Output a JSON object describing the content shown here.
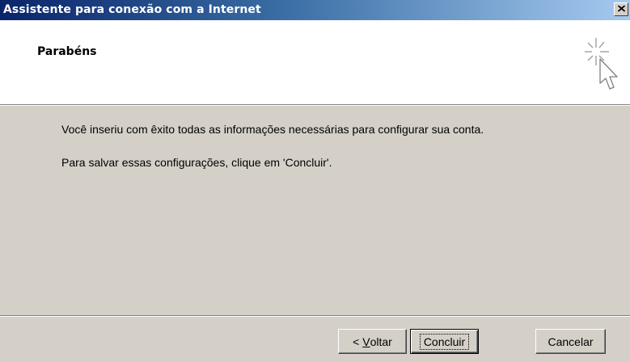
{
  "window": {
    "title": "Assistente para conexão com a Internet",
    "close_icon": "close-x-icon"
  },
  "header": {
    "title": "Parabéns",
    "icon": "wizard-cursor-sparkle-icon"
  },
  "body": {
    "line1": "Você inseriu com êxito todas as informações necessárias para configurar sua conta.",
    "line2": "Para salvar essas configurações, clique em 'Concluir'."
  },
  "buttons": {
    "back_prefix": "< ",
    "back_mnemonic": "V",
    "back_rest": "oltar",
    "finish": "Concluir",
    "cancel": "Cancelar"
  },
  "colors": {
    "titlebar_start": "#0a246a",
    "titlebar_end": "#a6caf0",
    "dialog_face": "#d4d0c8",
    "header_bg": "#ffffff"
  }
}
